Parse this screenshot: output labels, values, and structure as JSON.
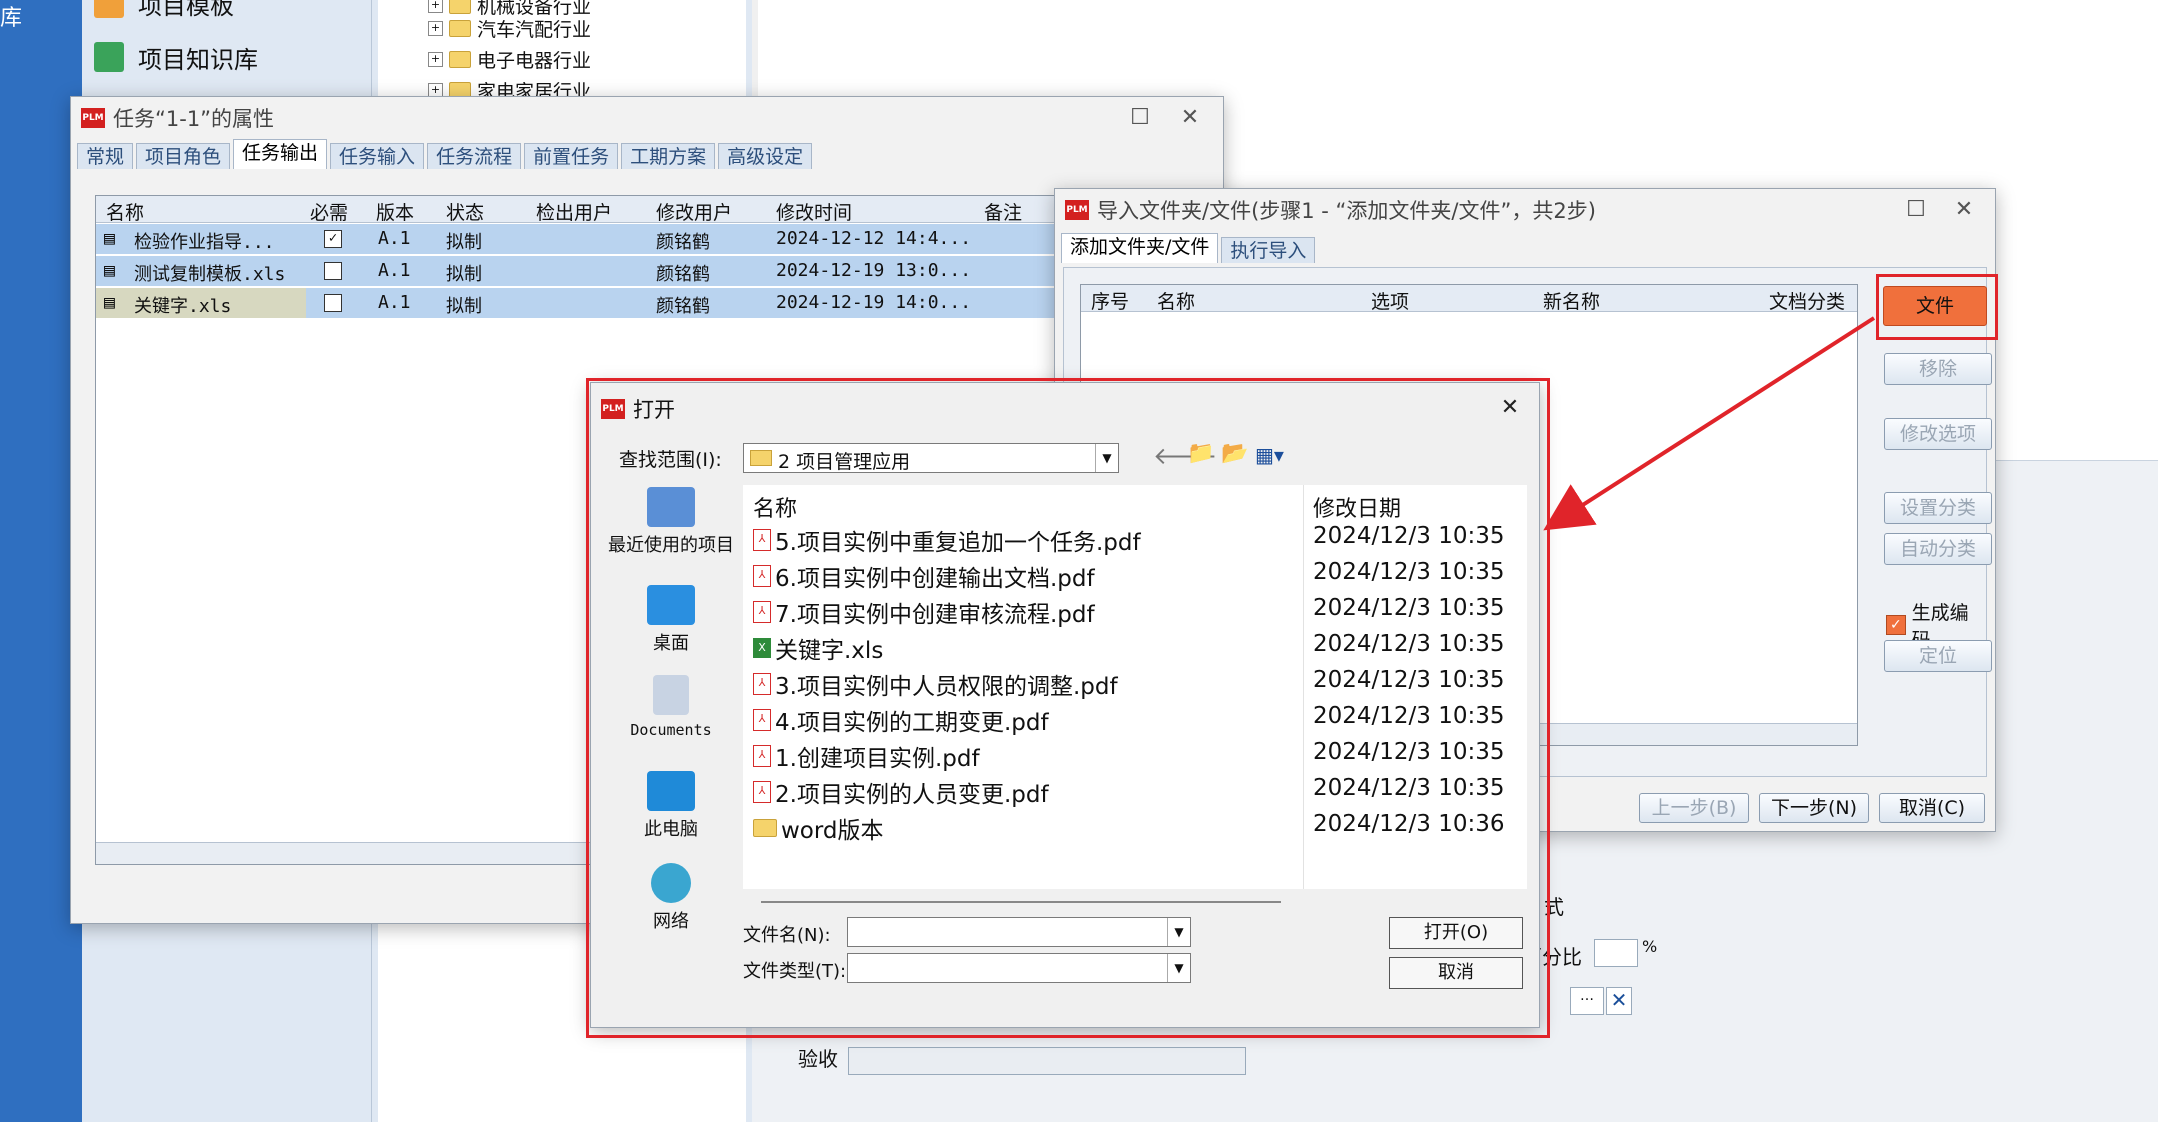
{
  "background": {
    "leftbar_char": "库",
    "nav_items": [
      {
        "label": "项目模板"
      },
      {
        "label": "项目知识库"
      }
    ],
    "tree_items": [
      "机械设备行业",
      "汽车汽配行业",
      "电子电器行业",
      "家电家居行业"
    ],
    "lower_labels": {
      "acceptance": "验收",
      "percent_label": "百分比",
      "percent_sign": "%",
      "mode_label": "式"
    }
  },
  "task_window": {
    "title": "任务“1-1”的属性",
    "tabs": [
      "常规",
      "项目角色",
      "任务输出",
      "任务输入",
      "任务流程",
      "前置任务",
      "工期方案",
      "高级设定"
    ],
    "active_tab": "任务输出",
    "columns": [
      "名称",
      "必需",
      "版本",
      "状态",
      "检出用户",
      "修改用户",
      "修改时间",
      "备注"
    ],
    "rows": [
      {
        "name": "检验作业指导...",
        "required": true,
        "version": "A.1",
        "status": "拟制",
        "checkout": "",
        "modifier": "颜铭鹤",
        "time": "2024-12-12 14:4...",
        "note": ""
      },
      {
        "name": "测试复制模板.xls",
        "required": false,
        "version": "A.1",
        "status": "拟制",
        "checkout": "",
        "modifier": "颜铭鹤",
        "time": "2024-12-19 13:0...",
        "note": ""
      },
      {
        "name": "关键字.xls",
        "required": false,
        "version": "A.1",
        "status": "拟制",
        "checkout": "",
        "modifier": "颜铭鹤",
        "time": "2024-12-19 14:0...",
        "note": ""
      }
    ]
  },
  "import_window": {
    "title": "导入文件夹/文件(步骤1 - “添加文件夹/文件”，共2步)",
    "tabs": [
      "添加文件夹/文件",
      "执行导入"
    ],
    "columns": [
      "序号",
      "名称",
      "选项",
      "新名称",
      "文档分类"
    ],
    "buttons": {
      "file": "文件",
      "remove": "移除",
      "modify_option": "修改选项",
      "set_category": "设置分类",
      "auto_category": "自动分类",
      "locate": "定位",
      "prev": "上一步(B)",
      "next": "下一步(N)",
      "cancel": "取消(C)"
    },
    "generate_code_label": "生成编码",
    "generate_code_checked": true
  },
  "open_dialog": {
    "title": "打开",
    "look_in_label": "查找范围(I):",
    "look_in_value": "2 项目管理应用",
    "places": [
      "最近使用的项目",
      "桌面",
      "Documents",
      "此电脑",
      "网络"
    ],
    "columns": {
      "name": "名称",
      "date": "修改日期"
    },
    "files": [
      {
        "name": "5.项目实例中重复追加一个任务.pdf",
        "date": "2024/12/3 10:35",
        "type": "pdf"
      },
      {
        "name": "6.项目实例中创建输出文档.pdf",
        "date": "2024/12/3 10:35",
        "type": "pdf"
      },
      {
        "name": "7.项目实例中创建审核流程.pdf",
        "date": "2024/12/3 10:35",
        "type": "pdf"
      },
      {
        "name": "关键字.xls",
        "date": "2024/12/3 10:35",
        "type": "xls"
      },
      {
        "name": "3.项目实例中人员权限的调整.pdf",
        "date": "2024/12/3 10:35",
        "type": "pdf"
      },
      {
        "name": "4.项目实例的工期变更.pdf",
        "date": "2024/12/3 10:35",
        "type": "pdf"
      },
      {
        "name": "1.创建项目实例.pdf",
        "date": "2024/12/3 10:35",
        "type": "pdf"
      },
      {
        "name": "2.项目实例的人员变更.pdf",
        "date": "2024/12/3 10:35",
        "type": "pdf"
      },
      {
        "name": "word版本",
        "date": "2024/12/3 10:36",
        "type": "folder"
      }
    ],
    "filename_label": "文件名(N):",
    "filename_value": "",
    "filetype_label": "文件类型(T):",
    "filetype_value": "",
    "open_button": "打开(O)",
    "cancel_button": "取消"
  },
  "annotation_color": "#e0242a"
}
